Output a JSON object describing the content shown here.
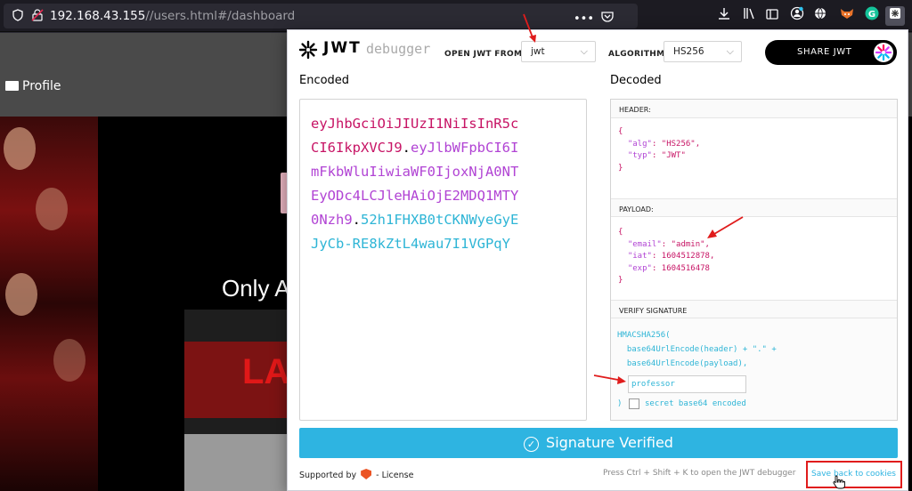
{
  "browser": {
    "url_host": "192.168.43.155",
    "url_path": "//users.html#/dashboard",
    "icons": [
      "shield-icon",
      "insecure-lock-icon",
      "more-icon",
      "pocket-icon",
      "bookmark-star-icon",
      "download-icon",
      "library-icon",
      "sidebar-icon",
      "account-icon",
      "globe-icon",
      "fox-extension-icon",
      "grammarly-icon",
      "jwt-extension-icon"
    ],
    "grammarly_letter": "G"
  },
  "site": {
    "profile_label": "Profile",
    "hero_text": "Only A",
    "poster_text": "LA"
  },
  "jwt": {
    "logo_word": "JWT",
    "logo_sub": "debugger",
    "open_from_label": "OPEN JWT FROM",
    "open_from_value": "jwt",
    "algorithm_label": "ALGORITHM",
    "algorithm_value": "HS256",
    "share_label": "SHARE JWT",
    "encoded_title": "Encoded",
    "decoded_title": "Decoded",
    "encoded_lines": [
      {
        "header": "eyJhbGciOiJIUzI1NiIsInR5c",
        "dot1": "",
        "payload": "",
        "dot2": "",
        "signature": ""
      },
      {
        "header": "CI6IkpXVCJ9",
        "dot1": ".",
        "payload": "eyJlbWFpbCI6I",
        "dot2": "",
        "signature": ""
      },
      {
        "header": "",
        "dot1": "",
        "payload": "mFkbWluIiwiaWF0IjoxNjA0NT",
        "dot2": "",
        "signature": ""
      },
      {
        "header": "",
        "dot1": "",
        "payload": "EyODc4LCJleHAiOjE2MDQ1MTY",
        "dot2": "",
        "signature": ""
      },
      {
        "header": "",
        "dot1": "",
        "payload": "0Nzh9",
        "dot2": ".",
        "signature": "52h1FHXB0tCKNWyeGyE"
      },
      {
        "header": "",
        "dot1": "",
        "payload": "",
        "dot2": "",
        "signature": "JyCb-RE8kZtL4wau7I1VGPqY"
      }
    ],
    "header_label": "HEADER:",
    "header_json": {
      "open": "{",
      "alg_key": "\"alg\"",
      "alg_val": ": \"HS256\",",
      "typ_key": "\"typ\"",
      "typ_val": ": \"JWT\"",
      "close": "}"
    },
    "payload_label": "PAYLOAD:",
    "payload_json": {
      "open": "{",
      "email_key": "\"email\"",
      "email_val": ": \"admin\",",
      "iat_key": "\"iat\"",
      "iat_val": ": 1604512878,",
      "exp_key": "\"exp\"",
      "exp_val": ": 1604516478",
      "close": "}"
    },
    "verify_label": "VERIFY SIGNATURE",
    "verify_code": [
      "HMACSHA256(",
      "  base64UrlEncode(header) + \".\" +",
      "  base64UrlEncode(payload),"
    ],
    "secret_value": "professor",
    "close_paren": ")",
    "secret_encoded_label": "secret base64 encoded",
    "verified_text": "Signature Verified",
    "supported_by": "Supported by",
    "license": "- License",
    "shortcut_hint": "Press Ctrl + Shift + K to open the JWT debugger",
    "save_cookies": "Save back to cookies"
  },
  "colors": {
    "header_token": "#c71465",
    "payload_token": "#b144d4",
    "signature_token": "#2eb5d6",
    "verified_bar": "#2eb4e1",
    "annotation_red": "#e01c1c"
  }
}
